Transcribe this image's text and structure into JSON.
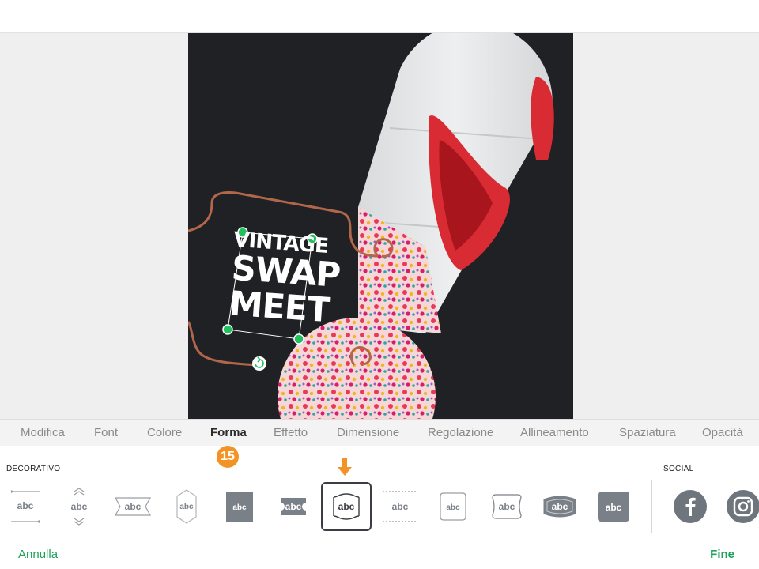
{
  "canvas": {
    "title_lines": [
      "VINTAGE",
      "SWAP",
      "MEET"
    ]
  },
  "menu": {
    "items": [
      "Modifica",
      "Font",
      "Colore",
      "Forma",
      "Effetto",
      "Dimensione",
      "Regolazione",
      "Allineamento",
      "Spaziatura",
      "Opacità"
    ],
    "active": "Forma"
  },
  "step_badge": "15",
  "panel": {
    "decorative_label": "DECORATIVO",
    "social_label": "SOCIAL",
    "sample_text": "abc",
    "selected_style": 7
  },
  "icons": {
    "arrow": "down-arrow-icon",
    "rotate": "rotate-icon",
    "facebook": "facebook-icon",
    "instagram": "instagram-icon"
  },
  "colors": {
    "accent_orange": "#f39325",
    "action_green": "#1fa35c",
    "handle_green": "#23c05e",
    "shape_outline": "#b2664a",
    "tile_gray": "#7a8088"
  },
  "footer": {
    "cancel": "Annulla",
    "done": "Fine"
  }
}
